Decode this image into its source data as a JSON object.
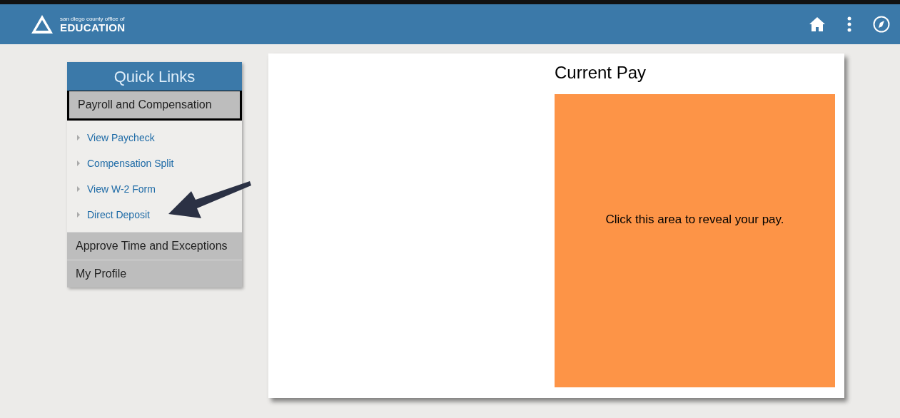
{
  "header": {
    "logo_overline": "san diego county office of",
    "logo_title": "EDUCATION"
  },
  "quick_links": {
    "title": "Quick Links",
    "sections": [
      {
        "label": "Payroll and Compensation",
        "selected": true,
        "expanded": true,
        "links": [
          "View Paycheck",
          "Compensation Split",
          "View W-2 Form",
          "Direct Deposit"
        ]
      },
      {
        "label": "Approve Time and Exceptions",
        "selected": false,
        "expanded": false
      },
      {
        "label": "My Profile",
        "selected": false,
        "expanded": false
      }
    ]
  },
  "current_pay": {
    "title": "Current Pay",
    "reveal_text": "Click this area to reveal your pay."
  }
}
